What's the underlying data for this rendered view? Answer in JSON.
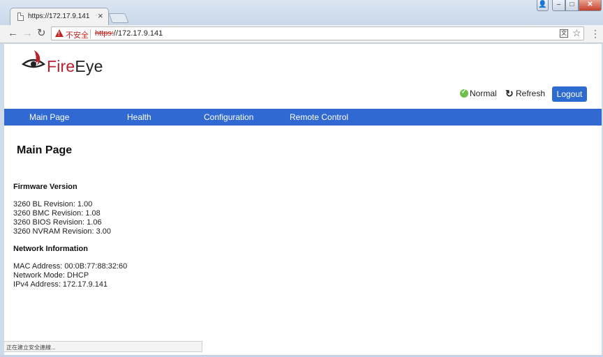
{
  "browser": {
    "tab_title": "https://172.17.9.141",
    "security_label": "不安全",
    "url_scheme": "https:",
    "url_rest": "//172.17.9.141",
    "status_text": "正在建立安全連線..."
  },
  "header": {
    "logo_prefix": "Fire",
    "logo_suffix": "Eye",
    "status_label": "Normal",
    "refresh_label": "Refresh",
    "logout_label": "Logout"
  },
  "nav": [
    {
      "label": "Main Page"
    },
    {
      "label": "Health"
    },
    {
      "label": "Configuration"
    },
    {
      "label": "Remote Control"
    }
  ],
  "main": {
    "title": "Main Page",
    "firmware": {
      "heading": "Firmware Version",
      "lines": [
        "3260 BL Revision: 1.00",
        "3260 BMC Revision: 1.08",
        "3260 BIOS Revision: 1.06",
        "3260 NVRAM Revision: 3.00"
      ]
    },
    "network": {
      "heading": "Network Information",
      "lines": [
        "MAC Address: 00:0B:77:88:32:60",
        "Network Mode: DHCP",
        "IPv4 Address: 172.17.9.141"
      ]
    }
  },
  "colors": {
    "accent_blue": "#3069d1",
    "logo_red": "#b8202e",
    "status_green": "#6cc14a",
    "insecure_red": "#c5221f"
  }
}
